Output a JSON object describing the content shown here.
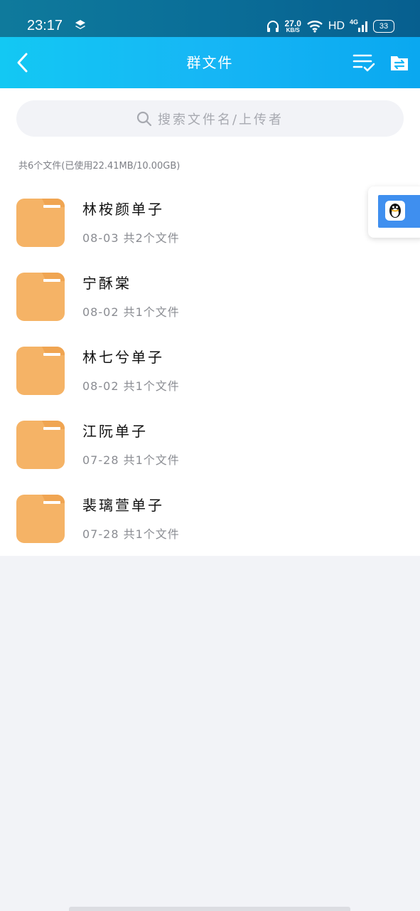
{
  "status_bar": {
    "time": "23:17",
    "net_speed_value": "27.0",
    "net_speed_unit": "KB/S",
    "hd": "HD",
    "network": "4G",
    "battery": "33"
  },
  "nav": {
    "title": "群文件"
  },
  "search": {
    "placeholder": "搜索文件名/上传者"
  },
  "summary": "共6个文件(已使用22.41MB/10.00GB)",
  "folders": [
    {
      "name": "林桉颜单子",
      "meta": "08-03  共2个文件"
    },
    {
      "name": "宁酥棠",
      "meta": "08-02  共1个文件"
    },
    {
      "name": "林七兮单子",
      "meta": "08-02  共1个文件"
    },
    {
      "name": "江阮单子",
      "meta": "07-28  共1个文件"
    },
    {
      "name": "裴璃萱单子",
      "meta": "07-28  共1个文件"
    }
  ],
  "colors": {
    "status_bar": "#0a6e98",
    "nav_bar": "#16b6f5",
    "folder": "#f5b366",
    "background": "#f2f3f7"
  }
}
